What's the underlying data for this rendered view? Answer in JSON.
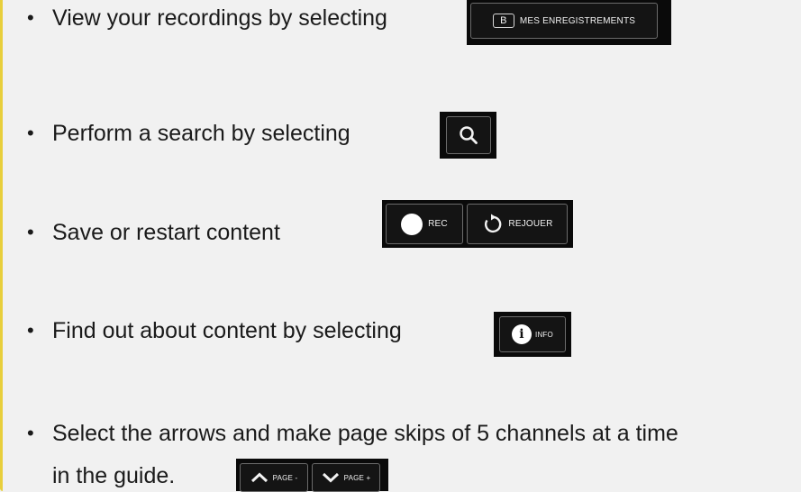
{
  "bullets": [
    {
      "symbol": "•",
      "text": "View your recordings by selecting"
    },
    {
      "symbol": "•",
      "text": "Perform a search by selecting"
    },
    {
      "symbol": "•",
      "text": "Save or restart content"
    },
    {
      "symbol": "•",
      "text": "Find out about content by selecting"
    },
    {
      "symbol": "•",
      "text": "Select the arrows and make page skips of 5 channels at a time",
      "continuation": "in the guide."
    }
  ],
  "buttons": {
    "recordings": {
      "key": "B",
      "label": "MES ENREGISTREMENTS"
    },
    "search": {
      "icon": "search-icon"
    },
    "rec": {
      "label": "REC",
      "icon": "record-dot-icon"
    },
    "replay": {
      "label": "REJOUER",
      "icon": "replay-arrow-icon"
    },
    "info": {
      "label": "INFO",
      "icon": "info-icon",
      "glyph": "i"
    },
    "page_up": {
      "label": "PAGE -",
      "icon": "chevron-up-icon"
    },
    "page_down": {
      "label": "PAGE +",
      "icon": "chevron-down-icon"
    }
  },
  "colors": {
    "background": "#f1f1f1",
    "accent": "#e8cf3c",
    "button_bg": "#0a0a0a",
    "button_text": "#f2f2f2"
  }
}
